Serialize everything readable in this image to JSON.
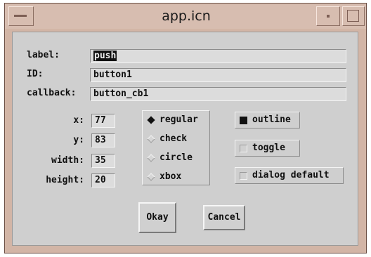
{
  "window": {
    "title": "app.icn"
  },
  "fields": {
    "label": {
      "caption": "label:",
      "value": "push"
    },
    "id": {
      "caption": "ID:",
      "value": "button1"
    },
    "callback": {
      "caption": "callback:",
      "value": "button_cb1"
    }
  },
  "coords": {
    "x": {
      "caption": "x:",
      "value": "77"
    },
    "y": {
      "caption": "y:",
      "value": "83"
    },
    "width": {
      "caption": "width:",
      "value": "35"
    },
    "height": {
      "caption": "height:",
      "value": "20"
    }
  },
  "style_options": [
    {
      "label": "regular",
      "selected": true
    },
    {
      "label": "check",
      "selected": false
    },
    {
      "label": "circle",
      "selected": false
    },
    {
      "label": "xbox",
      "selected": false
    }
  ],
  "toggles": [
    {
      "label": "outline",
      "checked": true
    },
    {
      "label": "toggle",
      "checked": false
    },
    {
      "label": "dialog default",
      "checked": false
    }
  ],
  "buttons": {
    "okay": "Okay",
    "cancel": "Cancel"
  }
}
